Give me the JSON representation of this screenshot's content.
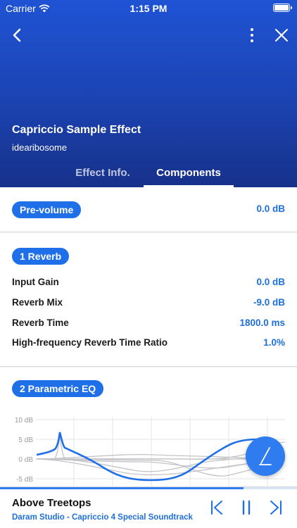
{
  "status": {
    "carrier": "Carrier",
    "time": "1:15 PM"
  },
  "effect": {
    "title": "Capriccio Sample Effect",
    "author": "idearibosome"
  },
  "tabs": [
    {
      "label": "Effect Info.",
      "active": false
    },
    {
      "label": "Components",
      "active": true
    }
  ],
  "pre_volume": {
    "label": "Pre-volume",
    "value": "0.0 dB"
  },
  "reverb": {
    "label": "1 Reverb",
    "params": [
      {
        "label": "Input Gain",
        "value": "0.0 dB"
      },
      {
        "label": "Reverb Mix",
        "value": "-9.0 dB"
      },
      {
        "label": "Reverb Time",
        "value": "1800.0 ms"
      },
      {
        "label": "High-frequency Reverb Time Ratio",
        "value": "1.0%"
      }
    ]
  },
  "eq": {
    "label": "2 Parametric EQ",
    "y_ticks": [
      "10 dB",
      "5 dB",
      "0 dB",
      "-5 dB"
    ]
  },
  "player": {
    "title": "Above Treetops",
    "subtitle": "Daram Studio - Capriccio 4 Special Soundtrack",
    "progress": 0.82
  },
  "colors": {
    "accent": "#1f6fe8",
    "value": "#1e6fd9",
    "header": "#1c46b8"
  },
  "icons": [
    "chevron-left-icon",
    "more-vertical-icon",
    "close-icon",
    "edit-pen-icon",
    "skip-previous-icon",
    "pause-icon",
    "skip-next-icon",
    "wifi-icon",
    "battery-icon"
  ]
}
